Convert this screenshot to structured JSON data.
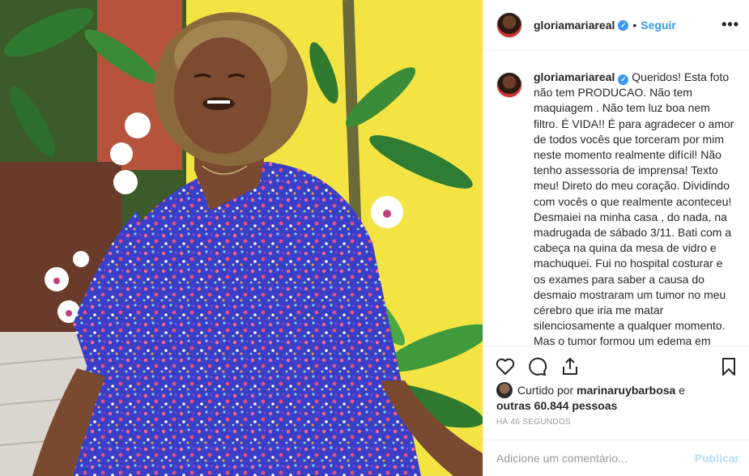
{
  "post": {
    "username": "gloriamariareal",
    "verified_mark": "✓",
    "dot": "•",
    "follow_label": "Seguir",
    "more_label": "•••"
  },
  "caption": {
    "username": "gloriamariareal",
    "text": "Queridos! Esta foto\nnão tem PRODUCAO. Não tem\nmaquiagem . Não tem luz boa nem\nfiltro. É VIDA!! É para agradecer o amor\nde todos vocês que torceram por mim\nneste momento realmente difícil! Não\ntenho assessoria de imprensa! Texto\nmeu! Direto do meu coração. Dividindo\ncom vocês o que realmente aconteceu!\nDesmaiei na minha casa , do nada, na\nmadrugada de sábado 3/11. Bati com a\ncabeça na quina da mesa de vidro e\nmachuquei. Fui no hospital costurar e\nos exames para saber a causa do\ndesmaio mostraram um tumor no meu\ncérebro que iria me matar\nsilenciosamente a qualquer momento.\nMas o tumor formou um edema em\nvolta dele que inflamou e me fez"
  },
  "likes": {
    "prefix": "Curtido por",
    "user": "marinaruybarbosa",
    "conj": "e",
    "others": "outras 60.844 pessoas"
  },
  "timestamp": "HÁ 46 SEGUNDOS",
  "comment": {
    "placeholder": "Adicione um comentário...",
    "publish_label": "Publicar"
  },
  "icons": {
    "like": "heart-icon",
    "comment": "comment-icon",
    "share": "share-icon",
    "save": "bookmark-icon"
  },
  "colors": {
    "link": "#3897f0",
    "publish_disabled": "#b2dffc",
    "muted": "#999999"
  }
}
